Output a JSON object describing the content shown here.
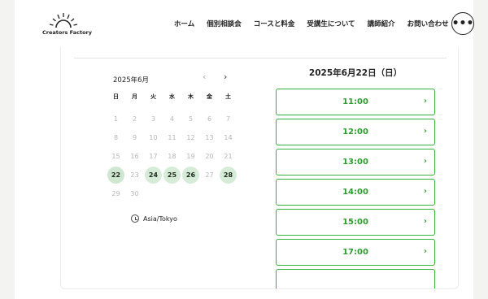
{
  "header": {
    "logo_text": "Creators Factory",
    "nav": [
      "ホーム",
      "個別相談会",
      "コースと料金",
      "受講生について",
      "講師紹介",
      "お問い合わせ"
    ],
    "menu_icon": "more-horizontal-icon"
  },
  "calendar": {
    "month_label": "2025年6月",
    "weekdays": [
      "日",
      "月",
      "火",
      "水",
      "木",
      "金",
      "土"
    ],
    "days": [
      {
        "d": "1",
        "state": "off"
      },
      {
        "d": "2",
        "state": "off"
      },
      {
        "d": "3",
        "state": "off"
      },
      {
        "d": "4",
        "state": "off"
      },
      {
        "d": "5",
        "state": "off"
      },
      {
        "d": "6",
        "state": "off"
      },
      {
        "d": "7",
        "state": "off"
      },
      {
        "d": "8",
        "state": "off"
      },
      {
        "d": "9",
        "state": "off"
      },
      {
        "d": "10",
        "state": "off"
      },
      {
        "d": "11",
        "state": "off"
      },
      {
        "d": "12",
        "state": "off"
      },
      {
        "d": "13",
        "state": "off"
      },
      {
        "d": "14",
        "state": "off"
      },
      {
        "d": "15",
        "state": "off"
      },
      {
        "d": "16",
        "state": "off"
      },
      {
        "d": "17",
        "state": "off"
      },
      {
        "d": "18",
        "state": "off"
      },
      {
        "d": "19",
        "state": "off"
      },
      {
        "d": "20",
        "state": "off"
      },
      {
        "d": "21",
        "state": "off"
      },
      {
        "d": "22",
        "state": "selected"
      },
      {
        "d": "23",
        "state": "off"
      },
      {
        "d": "24",
        "state": "avail"
      },
      {
        "d": "25",
        "state": "avail"
      },
      {
        "d": "26",
        "state": "avail"
      },
      {
        "d": "27",
        "state": "off"
      },
      {
        "d": "28",
        "state": "avail"
      },
      {
        "d": "29",
        "state": "off"
      },
      {
        "d": "30",
        "state": "off"
      }
    ],
    "timezone": "Asia/Tokyo",
    "colors": {
      "available_bg": "#d7ecd8",
      "disabled_text": "#b5b5b5"
    }
  },
  "slots": {
    "date_heading": "2025年6月22日（日）",
    "times": [
      "11:00",
      "12:00",
      "13:00",
      "14:00",
      "15:00",
      "17:00"
    ],
    "colors": {
      "accent": "#35b23c"
    }
  }
}
